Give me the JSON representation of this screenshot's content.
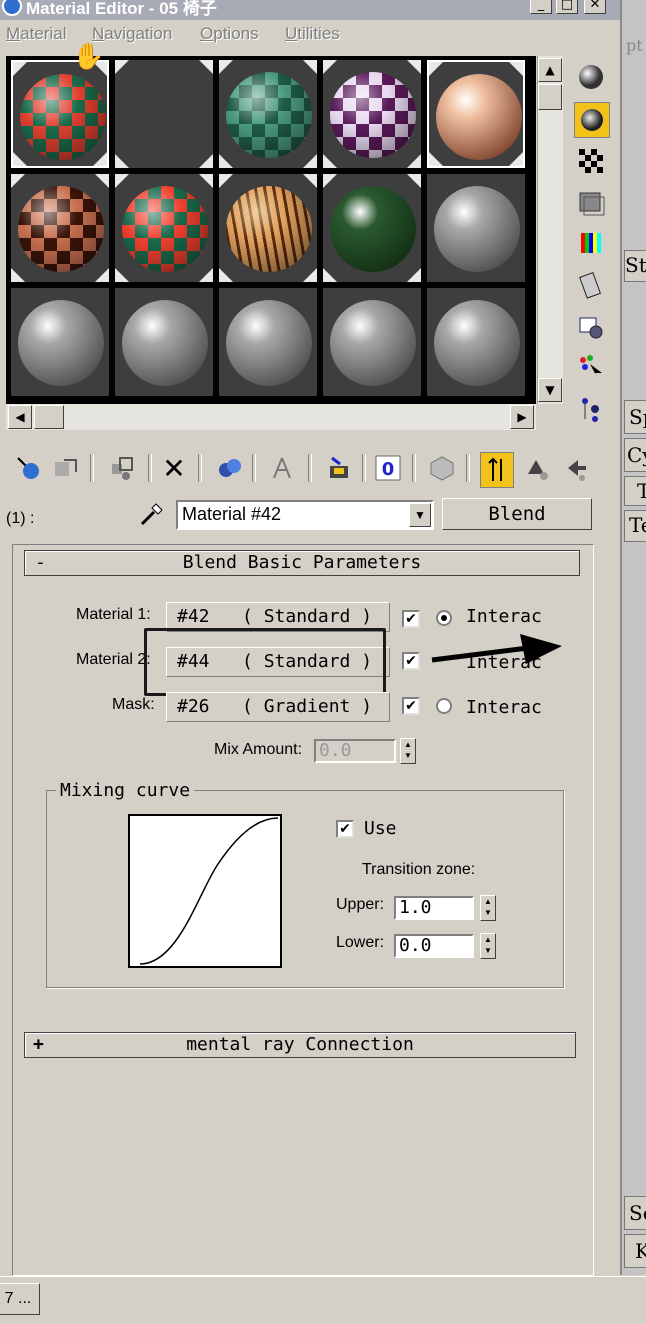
{
  "window": {
    "title": "Material Editor - 05 椅子",
    "buttons": {
      "minimize": "_",
      "maximize": "□",
      "close": "✕"
    }
  },
  "menu": [
    {
      "label": "Material",
      "u": "M",
      "rest": "aterial"
    },
    {
      "label": "Navigation",
      "u": "N",
      "rest": "avigation"
    },
    {
      "label": "Options",
      "u": "O",
      "rest": "ptions"
    },
    {
      "label": "Utilities",
      "u": "U",
      "rest": "tilities"
    }
  ],
  "right_strip": [
    "pt",
    "St",
    "Sp",
    "Cyl",
    "T",
    "Te",
    "Se",
    "K"
  ],
  "sample_slots": [
    {
      "name": "slot-1",
      "colors": [
        "#e04030",
        "#1a6a4a"
      ],
      "pattern": "checker-red"
    },
    {
      "name": "slot-2",
      "colors": [
        "#3e3e3e",
        "#3e3e3e"
      ],
      "pattern": "empty"
    },
    {
      "name": "slot-3",
      "colors": [
        "#4a9a80",
        "#1e5a48"
      ],
      "pattern": "checker-green"
    },
    {
      "name": "slot-4",
      "colors": [
        "#e8d8f0",
        "#5a1a5a"
      ],
      "pattern": "checker-purple"
    },
    {
      "name": "slot-5",
      "colors": [
        "#f0c0a0",
        "#5a1a08"
      ],
      "pattern": "glossy-brown"
    },
    {
      "name": "slot-6",
      "colors": [
        "#c87050",
        "#3a1408"
      ],
      "pattern": "checker-brown"
    },
    {
      "name": "slot-7",
      "colors": [
        "#f04030",
        "#1a6a4a"
      ],
      "pattern": "checker-bright"
    },
    {
      "name": "slot-8",
      "colors": [
        "#e0a060",
        "#5a2a08"
      ],
      "pattern": "wood"
    },
    {
      "name": "slot-9",
      "colors": [
        "#2a5a30",
        "#0a200a"
      ],
      "pattern": "dark-green"
    },
    {
      "name": "slot-10",
      "colors": [
        "#a8a8a8",
        "#303030"
      ],
      "pattern": "gray"
    },
    {
      "name": "slot-11",
      "colors": [
        "#a8a8a8",
        "#303030"
      ],
      "pattern": "gray"
    },
    {
      "name": "slot-12",
      "colors": [
        "#a8a8a8",
        "#303030"
      ],
      "pattern": "gray"
    },
    {
      "name": "slot-13",
      "colors": [
        "#a8a8a8",
        "#303030"
      ],
      "pattern": "gray"
    },
    {
      "name": "slot-14",
      "colors": [
        "#a8a8a8",
        "#303030"
      ],
      "pattern": "gray"
    },
    {
      "name": "slot-15",
      "colors": [
        "#a8a8a8",
        "#303030"
      ],
      "pattern": "gray"
    }
  ],
  "side_tools": [
    "sample-type-sphere-icon",
    "backlight-icon",
    "background-checker-icon",
    "sample-uv-tiling-icon",
    "video-color-check-icon",
    "make-preview-icon",
    "options-icon",
    "select-by-material-icon",
    "material-map-navigator-icon"
  ],
  "toolbar_icons": [
    "get-material-icon",
    "put-to-scene-icon",
    "assign-to-selection-icon",
    "reset-map-icon",
    "make-copy-icon",
    "make-unique-icon",
    "put-to-library-icon",
    "material-id-channel-icon",
    "show-map-in-viewport-icon",
    "show-end-result-icon",
    "go-to-parent-icon",
    "go-forward-to-sibling-icon"
  ],
  "level_label": "(1) :",
  "material_name": "Material #42",
  "material_type": "Blend",
  "blend": {
    "title": "Blend Basic Parameters",
    "collapse": "-",
    "rows": [
      {
        "label": "Material 1:",
        "slot": "#42   ( Standard )",
        "checked": true,
        "radio": true,
        "radio_label": "Interac"
      },
      {
        "label": "Material 2:",
        "slot": "#44   ( Standard )",
        "checked": true,
        "radio": false,
        "radio_label": "Interac"
      },
      {
        "label": "Mask:",
        "slot": "#26   ( Gradient )",
        "checked": true,
        "radio": false,
        "radio_label": "Interac"
      }
    ],
    "mix_amount_label": "Mix Amount:",
    "mix_amount": "0.0",
    "curve": {
      "title": "Mixing curve",
      "use_label": "Use",
      "use_checked": true,
      "transition_label": "Transition zone:",
      "upper_label": "Upper:",
      "upper": "1.0",
      "lower_label": "Lower:",
      "lower": "0.0"
    }
  },
  "mental_ray": {
    "title": "mental ray Connection",
    "expand": "+"
  },
  "status": {
    "task_label": "7 ..."
  },
  "check_mark": "✔"
}
